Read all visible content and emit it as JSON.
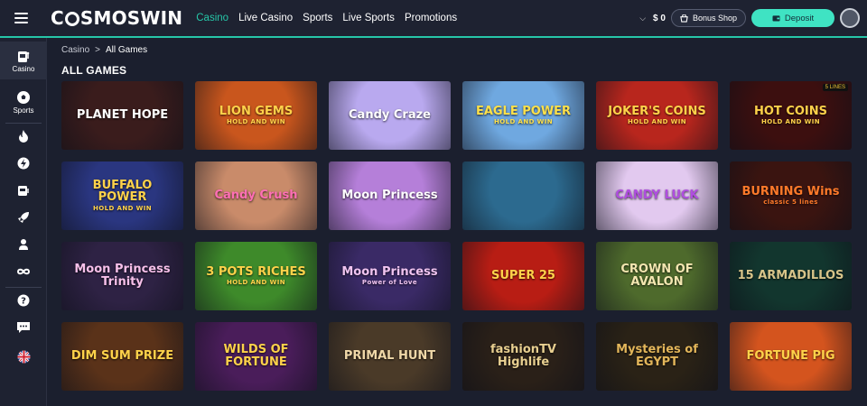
{
  "header": {
    "logo_pre": "C",
    "logo_post": "SMOSWIN",
    "nav": [
      "Casino",
      "Live Casino",
      "Sports",
      "Live Sports",
      "Promotions"
    ],
    "balance": "$ 0",
    "bonus_shop": "Bonus Shop",
    "deposit": "Deposit",
    "accent_color": "#26c6a8"
  },
  "sidebar": {
    "casino_label": "Casino",
    "sports_label": "Sports",
    "icons": [
      "fire-icon",
      "lightning-icon",
      "slot-machine-icon",
      "rocket-icon",
      "poker-player-icon",
      "infinity-icon",
      "help-icon",
      "chat-icon",
      "uk-flag-icon"
    ]
  },
  "breadcrumb": {
    "root": "Casino",
    "separator": ">",
    "current": "All Games"
  },
  "page_title": "ALL GAMES",
  "games": [
    {
      "name": "PLANET HOPE",
      "sub": "",
      "bg": "#3a1c1c",
      "fg": "#ffffff"
    },
    {
      "name": "LION GEMS",
      "sub": "HOLD AND WIN",
      "bg": "#c9561d",
      "fg": "#ffd24a"
    },
    {
      "name": "Candy Craze",
      "sub": "",
      "bg": "#b9a9ef",
      "fg": "#ffffff"
    },
    {
      "name": "EAGLE POWER",
      "sub": "HOLD AND WIN",
      "bg": "#6fa8e0",
      "fg": "#ffe14a"
    },
    {
      "name": "JOKER'S COINS",
      "sub": "HOLD AND WIN",
      "bg": "#b8261d",
      "fg": "#ffd24a"
    },
    {
      "name": "HOT COINS",
      "sub": "HOLD AND WIN",
      "bg": "#3c0f0f",
      "fg": "#ffd24a",
      "badge": "5 LINES"
    },
    {
      "name": "BUFFALO POWER",
      "sub": "HOLD AND WIN",
      "bg": "#2a3680",
      "fg": "#ffd24a"
    },
    {
      "name": "Candy Crush",
      "sub": "",
      "bg": "#c98b6a",
      "fg": "#ff6fb5"
    },
    {
      "name": "Moon Princess",
      "sub": "",
      "bg": "#b57fd9",
      "fg": "#ffffff"
    },
    {
      "name": "",
      "sub": "",
      "bg": "#2c6a8f",
      "fg": "#ffffff"
    },
    {
      "name": "CANDY LUCK",
      "sub": "",
      "bg": "#e2c9ef",
      "fg": "#b04de0"
    },
    {
      "name": "BURNING Wins",
      "sub": "classic 5 lines",
      "bg": "#3a1410",
      "fg": "#ff7a2a"
    },
    {
      "name": "Moon Princess Trinity",
      "sub": "",
      "bg": "#2e2244",
      "fg": "#f7c0ea"
    },
    {
      "name": "3 POTS RICHES",
      "sub": "HOLD AND WIN",
      "bg": "#3e8a2a",
      "fg": "#ffd24a"
    },
    {
      "name": "Moon Princess",
      "sub": "Power of Love",
      "bg": "#3a2a66",
      "fg": "#f0c4f0"
    },
    {
      "name": "SUPER 25",
      "sub": "",
      "bg": "#b81d14",
      "fg": "#ffd24a"
    },
    {
      "name": "CROWN OF AVALON",
      "sub": "",
      "bg": "#4e6a2c",
      "fg": "#f3e6b0"
    },
    {
      "name": "15 ARMADILLOS",
      "sub": "",
      "bg": "#12362e",
      "fg": "#d7c489"
    },
    {
      "name": "DIM SUM PRIZE",
      "sub": "",
      "bg": "#5a3219",
      "fg": "#ffd24a"
    },
    {
      "name": "WILDS OF FORTUNE",
      "sub": "",
      "bg": "#4a1d5a",
      "fg": "#ffd24a"
    },
    {
      "name": "PRIMAL HUNT",
      "sub": "",
      "bg": "#4a3a28",
      "fg": "#f0d8a8"
    },
    {
      "name": "fashionTV Highlife",
      "sub": "",
      "bg": "#2a2018",
      "fg": "#e8cf90"
    },
    {
      "name": "Mysteries of EGYPT",
      "sub": "",
      "bg": "#2a2216",
      "fg": "#e3b65a"
    },
    {
      "name": "FORTUNE PIG",
      "sub": "",
      "bg": "#d4541e",
      "fg": "#ffd24a"
    }
  ]
}
